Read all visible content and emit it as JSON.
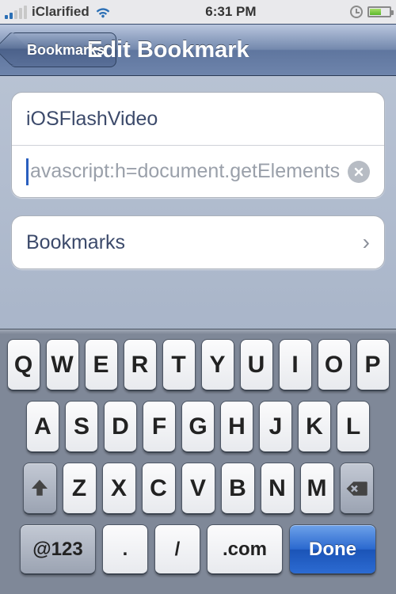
{
  "status": {
    "carrier": "iClarified",
    "time": "6:31 PM"
  },
  "nav": {
    "back": "Bookmarks",
    "title": "Edit Bookmark"
  },
  "form": {
    "name_value": "iOSFlashVideo",
    "url_value": "avascript:h=document.getElementsByT",
    "folder": "Bookmarks"
  },
  "keyboard": {
    "row1": [
      "Q",
      "W",
      "E",
      "R",
      "T",
      "Y",
      "U",
      "I",
      "O",
      "P"
    ],
    "row2": [
      "A",
      "S",
      "D",
      "F",
      "G",
      "H",
      "J",
      "K",
      "L"
    ],
    "row3": [
      "Z",
      "X",
      "C",
      "V",
      "B",
      "N",
      "M"
    ],
    "symbols": "@123",
    "dot": ".",
    "slash": "/",
    "com": ".com",
    "done": "Done"
  }
}
